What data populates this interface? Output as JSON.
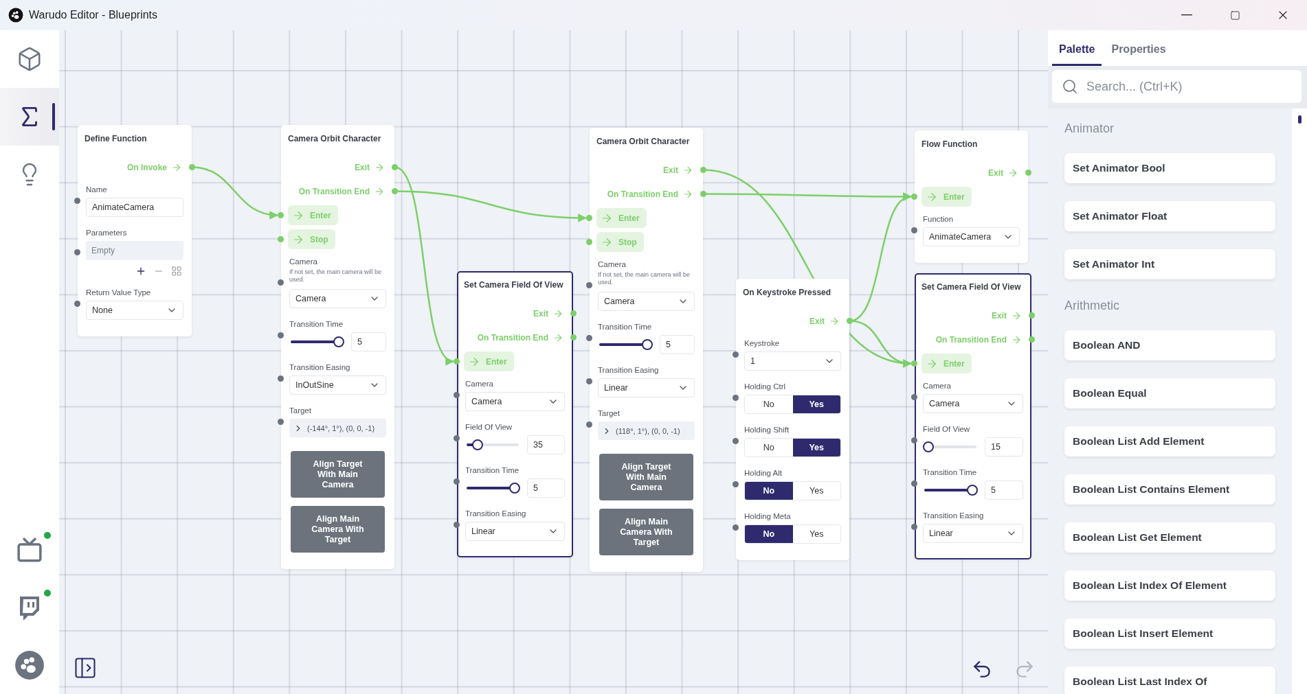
{
  "window": {
    "title": "Warudo Editor - Blueprints"
  },
  "sidebar": {
    "top": [
      {
        "kind": "cube",
        "selected": false
      },
      {
        "kind": "sigma",
        "selected": true
      },
      {
        "kind": "bulb",
        "selected": false
      }
    ],
    "bottom": [
      {
        "kind": "tv",
        "live": true
      },
      {
        "kind": "chat",
        "live": true
      },
      {
        "kind": "paw"
      }
    ]
  },
  "canvas": {
    "nodes": [
      {
        "title": "Define Function",
        "selected": false,
        "outputs": [
          "On Invoke"
        ],
        "fields": [
          {
            "kind": "text",
            "label": "Name",
            "value": "AnimateCamera"
          },
          {
            "kind": "list",
            "label": "Parameters",
            "placeholder": "Empty"
          },
          {
            "kind": "select",
            "label": "Return Value Type",
            "value": "None"
          }
        ]
      },
      {
        "title": "Camera Orbit Character",
        "selected": false,
        "outputs": [
          "Exit",
          "On Transition End"
        ],
        "inputs": [
          "Enter",
          "Stop"
        ],
        "fields": [
          {
            "kind": "select",
            "label": "Camera",
            "hint": "If not set, the main camera will be used.",
            "value": "Camera"
          },
          {
            "kind": "slider",
            "label": "Transition Time",
            "level": 1,
            "value": "5"
          },
          {
            "kind": "select",
            "label": "Transition Easing",
            "value": "InOutSine"
          },
          {
            "kind": "vector",
            "label": "Target",
            "value": "(-144°, 1°), (0, 0, -1)"
          }
        ],
        "actions": [
          "Align Target With Main Camera",
          "Align Main Camera With Target"
        ]
      },
      {
        "title": "Set Camera Field Of View",
        "selected": true,
        "outputs": [
          "Exit",
          "On Transition End"
        ],
        "inputs": [
          "Enter"
        ],
        "fields": [
          {
            "kind": "select",
            "label": "Camera",
            "value": "Camera"
          },
          {
            "kind": "slider",
            "label": "Field Of View",
            "level": 0.15,
            "value": "35"
          },
          {
            "kind": "slider",
            "label": "Transition Time",
            "level": 1,
            "value": "5"
          },
          {
            "kind": "select",
            "label": "Transition Easing",
            "value": "Linear"
          }
        ]
      },
      {
        "title": "Camera Orbit Character",
        "selected": false,
        "outputs": [
          "Exit",
          "On Transition End"
        ],
        "inputs": [
          "Enter",
          "Stop"
        ],
        "fields": [
          {
            "kind": "select",
            "label": "Camera",
            "hint": "If not set, the main camera will be used.",
            "value": "Camera"
          },
          {
            "kind": "slider",
            "label": "Transition Time",
            "level": 1,
            "value": "5"
          },
          {
            "kind": "select",
            "label": "Transition Easing",
            "value": "Linear"
          },
          {
            "kind": "vector",
            "label": "Target",
            "value": "(118°, 1°), (0, 0, -1)"
          }
        ],
        "actions": [
          "Align Target With Main Camera",
          "Align Main Camera With Target"
        ]
      },
      {
        "title": "On Keystroke Pressed",
        "selected": false,
        "outputs": [
          "Exit"
        ],
        "fields": [
          {
            "kind": "select",
            "label": "Keystroke",
            "value": "1"
          },
          {
            "kind": "toggle",
            "label": "Holding Ctrl",
            "options": [
              {
                "label": "No",
                "selected": false
              },
              {
                "label": "Yes",
                "selected": true
              }
            ]
          },
          {
            "kind": "toggle",
            "label": "Holding Shift",
            "options": [
              {
                "label": "No",
                "selected": false
              },
              {
                "label": "Yes",
                "selected": true
              }
            ]
          },
          {
            "kind": "toggle",
            "label": "Holding Alt",
            "options": [
              {
                "label": "No",
                "selected": true
              },
              {
                "label": "Yes",
                "selected": false
              }
            ]
          },
          {
            "kind": "toggle",
            "label": "Holding Meta",
            "options": [
              {
                "label": "No",
                "selected": true
              },
              {
                "label": "Yes",
                "selected": false
              }
            ]
          }
        ]
      },
      {
        "title": "Flow Function",
        "selected": false,
        "outputs": [
          "Exit"
        ],
        "inputs": [
          "Enter"
        ],
        "fields": [
          {
            "kind": "select",
            "label": "Function",
            "value": "AnimateCamera"
          }
        ]
      },
      {
        "title": "Set Camera Field Of View",
        "selected": true,
        "outputs": [
          "Exit",
          "On Transition End"
        ],
        "inputs": [
          "Enter"
        ],
        "fields": [
          {
            "kind": "select",
            "label": "Camera",
            "value": "Camera"
          },
          {
            "kind": "slider",
            "label": "Field Of View",
            "level": 0,
            "value": "15"
          },
          {
            "kind": "slider",
            "label": "Transition Time",
            "level": 1,
            "value": "5"
          },
          {
            "kind": "select",
            "label": "Transition Easing",
            "value": "Linear"
          }
        ]
      }
    ],
    "undo": {
      "disabled": false
    },
    "redo": {
      "disabled": true
    }
  },
  "panel": {
    "tabs": [
      {
        "label": "Palette",
        "selected": true
      },
      {
        "label": "Properties",
        "selected": false
      }
    ],
    "search": {
      "placeholder": "Search... (Ctrl+K)"
    },
    "groups": [
      {
        "title": "Animator",
        "items": [
          "Set Animator Bool",
          "Set Animator Float",
          "Set Animator Int"
        ]
      },
      {
        "title": "Arithmetic",
        "items": [
          "Boolean AND",
          "Boolean Equal",
          "Boolean List Add Element",
          "Boolean List Contains Element",
          "Boolean List Get Element",
          "Boolean List Index Of Element",
          "Boolean List Insert Element",
          "Boolean List Last Index Of"
        ]
      }
    ]
  }
}
